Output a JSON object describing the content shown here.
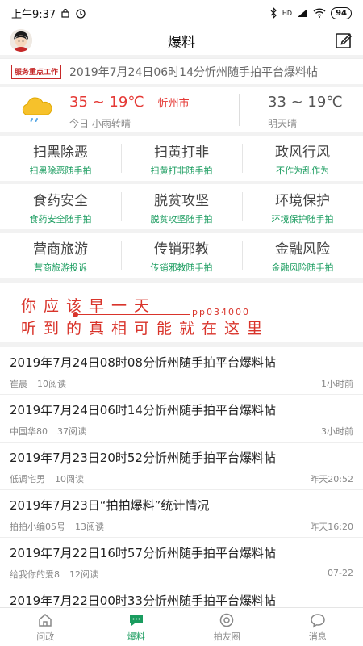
{
  "status_bar": {
    "time": "上午9:37",
    "battery": "94",
    "network": "HD"
  },
  "header": {
    "title": "爆料"
  },
  "ticker": {
    "badge": "服务重点工作",
    "text": "2019年7月24日06时14分忻州随手拍平台爆料帖"
  },
  "weather": {
    "today_temp": "35 ~ 19℃",
    "city": "忻州市",
    "today_label": "今日 小雨转晴",
    "tomorrow_temp": "33 ~ 19℃",
    "tomorrow_label": "明天晴"
  },
  "grid": {
    "rows": [
      [
        {
          "title": "扫黑除恶",
          "sub": "扫黑除恶随手拍"
        },
        {
          "title": "扫黄打非",
          "sub": "扫黄打非随手拍"
        },
        {
          "title": "政风行风",
          "sub": "不作为乱作为"
        }
      ],
      [
        {
          "title": "食药安全",
          "sub": "食药安全随手拍"
        },
        {
          "title": "脱贫攻坚",
          "sub": "脱贫攻坚随手拍"
        },
        {
          "title": "环境保护",
          "sub": "环境保护随手拍"
        }
      ],
      [
        {
          "title": "营商旅游",
          "sub": "营商旅游投诉"
        },
        {
          "title": "传销邪教",
          "sub": "传销邪教随手拍"
        },
        {
          "title": "金融风险",
          "sub": "金融风险随手拍"
        }
      ]
    ]
  },
  "banner": {
    "line1": "你应该早一天",
    "line2": "听到的真相可能就在这里",
    "code": "pp034000"
  },
  "news": [
    {
      "title": "2019年7月24日08时08分忻州随手拍平台爆料帖",
      "author": "崔晨",
      "reads": "10阅读",
      "time": "1小时前"
    },
    {
      "title": "2019年7月24日06时14分忻州随手拍平台爆料帖",
      "author": "中国华80",
      "reads": "37阅读",
      "time": "3小时前"
    },
    {
      "title": "2019年7月23日20时52分忻州随手拍平台爆料帖",
      "author": "低调宅男",
      "reads": "10阅读",
      "time": "昨天20:52"
    },
    {
      "title": "2019年7月23日“拍拍爆料”统计情况",
      "author": "拍拍小编05号",
      "reads": "13阅读",
      "time": "昨天16:20"
    },
    {
      "title": "2019年7月22日16时57分忻州随手拍平台爆料帖",
      "author": "给我你的爱8",
      "reads": "12阅读",
      "time": "07-22"
    },
    {
      "title": "2019年7月22日00时33分忻州随手拍平台爆料帖",
      "author": "",
      "reads": "",
      "time": ""
    }
  ],
  "tabs": [
    {
      "label": "问政",
      "icon": "home-icon"
    },
    {
      "label": "爆料",
      "icon": "chat-bubble-icon"
    },
    {
      "label": "拍友圈",
      "icon": "circle-icon"
    },
    {
      "label": "消息",
      "icon": "message-icon"
    }
  ],
  "colors": {
    "accent_green": "#1a9c5f",
    "alert_red": "#d9342b"
  }
}
